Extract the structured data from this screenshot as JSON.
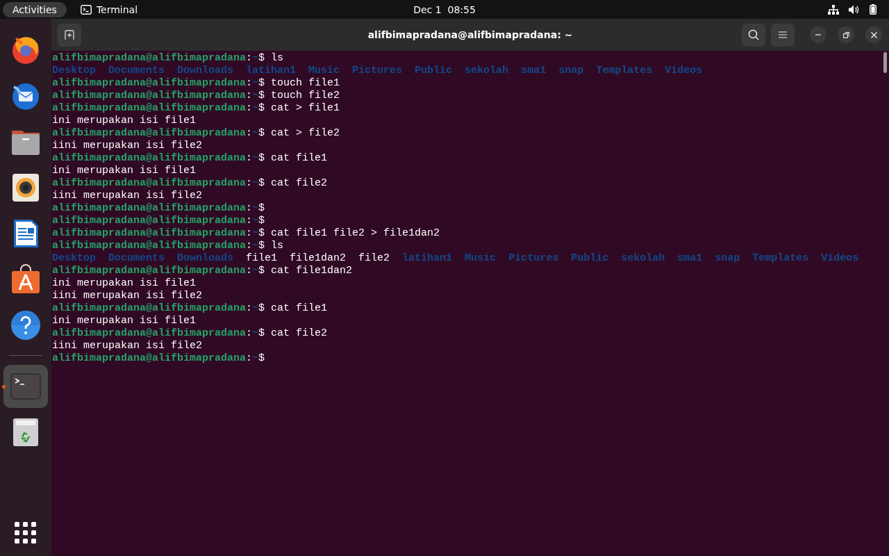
{
  "top_bar": {
    "activities": "Activities",
    "app_name": "Terminal",
    "clock": "Dec 1  08:55"
  },
  "dock": {
    "pinned": [
      {
        "kind": "browser",
        "selected": false
      },
      {
        "kind": "mail",
        "selected": false
      },
      {
        "kind": "files",
        "selected": false
      },
      {
        "kind": "music",
        "selected": false
      },
      {
        "kind": "writer",
        "selected": false
      },
      {
        "kind": "store",
        "selected": false
      },
      {
        "kind": "help",
        "selected": false
      }
    ],
    "running": [
      {
        "kind": "terminal",
        "selected": true
      },
      {
        "kind": "trash",
        "selected": false
      }
    ]
  },
  "window": {
    "title": "alifbimapradana@alifbimapradana: ~"
  },
  "terminal": {
    "lines": [
      {
        "kind": "prompt",
        "user": "alifbimapradana@alifbimapradana",
        "sep": ":",
        "path": "~",
        "command": "$ ls"
      },
      {
        "kind": "listing",
        "entries": [
          {
            "name": "Desktop",
            "kind": "dir"
          },
          {
            "name": "Documents",
            "kind": "dir"
          },
          {
            "name": "Downloads",
            "kind": "dir"
          },
          {
            "name": "latihan1",
            "kind": "dir"
          },
          {
            "name": "Music",
            "kind": "dir"
          },
          {
            "name": "Pictures",
            "kind": "dir"
          },
          {
            "name": "Public",
            "kind": "dir"
          },
          {
            "name": "sekolah",
            "kind": "dir"
          },
          {
            "name": "sma1",
            "kind": "dir"
          },
          {
            "name": "snap",
            "kind": "dir"
          },
          {
            "name": "Templates",
            "kind": "dir"
          },
          {
            "name": "Videos",
            "kind": "dir"
          }
        ]
      },
      {
        "kind": "prompt",
        "user": "alifbimapradana@alifbimapradana",
        "sep": ":",
        "path": "~",
        "command": "$ touch file1"
      },
      {
        "kind": "prompt",
        "user": "alifbimapradana@alifbimapradana",
        "sep": ":",
        "path": "~",
        "command": "$ touch file2"
      },
      {
        "kind": "prompt",
        "user": "alifbimapradana@alifbimapradana",
        "sep": ":",
        "path": "~",
        "command": "$ cat > file1"
      },
      {
        "kind": "output",
        "text": "ini merupakan isi file1"
      },
      {
        "kind": "prompt",
        "user": "alifbimapradana@alifbimapradana",
        "sep": ":",
        "path": "~",
        "command": "$ cat > file2"
      },
      {
        "kind": "output",
        "text": "iini merupakan isi file2"
      },
      {
        "kind": "prompt",
        "user": "alifbimapradana@alifbimapradana",
        "sep": ":",
        "path": "~",
        "command": "$ cat file1"
      },
      {
        "kind": "output",
        "text": "ini merupakan isi file1"
      },
      {
        "kind": "prompt",
        "user": "alifbimapradana@alifbimapradana",
        "sep": ":",
        "path": "~",
        "command": "$ cat file2"
      },
      {
        "kind": "output",
        "text": "iini merupakan isi file2"
      },
      {
        "kind": "prompt",
        "user": "alifbimapradana@alifbimapradana",
        "sep": ":",
        "path": "~",
        "command": "$"
      },
      {
        "kind": "prompt",
        "user": "alifbimapradana@alifbimapradana",
        "sep": ":",
        "path": "~",
        "command": "$"
      },
      {
        "kind": "prompt",
        "user": "alifbimapradana@alifbimapradana",
        "sep": ":",
        "path": "~",
        "command": "$ cat file1 file2 > file1dan2"
      },
      {
        "kind": "prompt",
        "user": "alifbimapradana@alifbimapradana",
        "sep": ":",
        "path": "~",
        "command": "$ ls"
      },
      {
        "kind": "listing",
        "entries": [
          {
            "name": "Desktop",
            "kind": "dir"
          },
          {
            "name": "Documents",
            "kind": "dir"
          },
          {
            "name": "Downloads",
            "kind": "dir"
          },
          {
            "name": "file1",
            "kind": "file"
          },
          {
            "name": "file1dan2",
            "kind": "file"
          },
          {
            "name": "file2",
            "kind": "file"
          },
          {
            "name": "latihan1",
            "kind": "dir"
          },
          {
            "name": "Music",
            "kind": "dir"
          },
          {
            "name": "Pictures",
            "kind": "dir"
          },
          {
            "name": "Public",
            "kind": "dir"
          },
          {
            "name": "sekolah",
            "kind": "dir"
          },
          {
            "name": "sma1",
            "kind": "dir"
          },
          {
            "name": "snap",
            "kind": "dir"
          },
          {
            "name": "Templates",
            "kind": "dir"
          },
          {
            "name": "Videos",
            "kind": "dir"
          }
        ]
      },
      {
        "kind": "prompt",
        "user": "alifbimapradana@alifbimapradana",
        "sep": ":",
        "path": "~",
        "command": "$ cat file1dan2"
      },
      {
        "kind": "output",
        "text": "ini merupakan isi file1"
      },
      {
        "kind": "output",
        "text": "iini merupakan isi file2"
      },
      {
        "kind": "prompt",
        "user": "alifbimapradana@alifbimapradana",
        "sep": ":",
        "path": "~",
        "command": "$ cat file1"
      },
      {
        "kind": "output",
        "text": "ini merupakan isi file1"
      },
      {
        "kind": "prompt",
        "user": "alifbimapradana@alifbimapradana",
        "sep": ":",
        "path": "~",
        "command": "$ cat file2"
      },
      {
        "kind": "output",
        "text": "iini merupakan isi file2"
      },
      {
        "kind": "prompt",
        "user": "alifbimapradana@alifbimapradana",
        "sep": ":",
        "path": "~",
        "command": "$"
      }
    ]
  }
}
